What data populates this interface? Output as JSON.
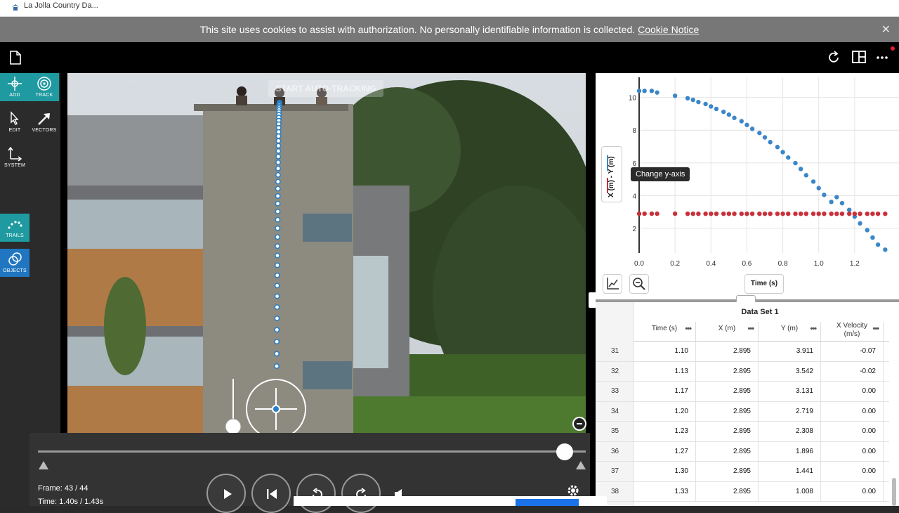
{
  "tab": {
    "title": "La Jolla Country Da..."
  },
  "cookie": {
    "text": "This site uses cookies to assist with authorization. No personally identifiable information is collected.",
    "link": "Cookie Notice",
    "close": "✕"
  },
  "toolbar": {
    "add": "ADD",
    "track": "TRACK",
    "edit": "EDIT",
    "vectors": "VECTORS",
    "system": "SYSTEM",
    "trails": "TRAILS",
    "objects": "OBJECTS"
  },
  "video": {
    "autotrack": "START AUTO-TRACKING"
  },
  "playback": {
    "frame": "Frame: 43 / 44",
    "time": "Time: 1.40s / 1.43s"
  },
  "graph": {
    "y_axis_label": "X (m) - Y (m)",
    "tooltip": "Change y-axis",
    "x_axis_button": "Time (s)"
  },
  "chart_data": {
    "type": "scatter",
    "xlabel": "Time (s)",
    "ylabel": "X (m) - Y (m)",
    "xlim": [
      0.0,
      1.4
    ],
    "ylim": [
      0.5,
      10.8
    ],
    "x_ticks": [
      "0.0",
      "0.2",
      "0.4",
      "0.6",
      "0.8",
      "1.0",
      "1.2"
    ],
    "y_ticks": [
      "2",
      "4",
      "6",
      "8",
      "10"
    ],
    "series": [
      {
        "name": "Y (m)",
        "color": "#3a86c8",
        "x": [
          0.0,
          0.03,
          0.07,
          0.1,
          0.2,
          0.27,
          0.3,
          0.33,
          0.37,
          0.4,
          0.43,
          0.47,
          0.5,
          0.53,
          0.57,
          0.6,
          0.63,
          0.67,
          0.7,
          0.73,
          0.77,
          0.8,
          0.83,
          0.87,
          0.9,
          0.93,
          0.97,
          1.0,
          1.03,
          1.07,
          1.1,
          1.13,
          1.17,
          1.2,
          1.23,
          1.27,
          1.3,
          1.33,
          1.37
        ],
        "y": [
          10.4,
          10.4,
          10.4,
          10.3,
          10.1,
          9.95,
          9.85,
          9.72,
          9.6,
          9.45,
          9.3,
          9.12,
          8.95,
          8.75,
          8.55,
          8.32,
          8.08,
          7.83,
          7.56,
          7.27,
          6.97,
          6.66,
          6.33,
          5.99,
          5.63,
          5.25,
          4.86,
          4.46,
          4.05,
          3.62,
          3.911,
          3.542,
          3.131,
          2.719,
          2.308,
          1.896,
          1.441,
          1.008,
          0.7
        ]
      },
      {
        "name": "X (m)",
        "color": "#c8303a",
        "x": [
          0.0,
          0.03,
          0.07,
          0.1,
          0.2,
          0.27,
          0.3,
          0.33,
          0.37,
          0.4,
          0.43,
          0.47,
          0.5,
          0.53,
          0.57,
          0.6,
          0.63,
          0.67,
          0.7,
          0.73,
          0.77,
          0.8,
          0.83,
          0.87,
          0.9,
          0.93,
          0.97,
          1.0,
          1.03,
          1.07,
          1.1,
          1.13,
          1.17,
          1.2,
          1.23,
          1.27,
          1.3,
          1.33,
          1.37
        ],
        "y": [
          2.9,
          2.9,
          2.9,
          2.9,
          2.9,
          2.895,
          2.895,
          2.895,
          2.895,
          2.895,
          2.895,
          2.895,
          2.895,
          2.895,
          2.895,
          2.895,
          2.895,
          2.895,
          2.895,
          2.895,
          2.895,
          2.895,
          2.895,
          2.895,
          2.895,
          2.895,
          2.895,
          2.895,
          2.895,
          2.895,
          2.895,
          2.895,
          2.895,
          2.895,
          2.895,
          2.895,
          2.895,
          2.895,
          2.895
        ]
      }
    ]
  },
  "table": {
    "title": "Data Set 1",
    "columns": [
      "Time (s)",
      "X (m)",
      "Y (m)",
      "X Velocity\n(m/s)"
    ],
    "rows": [
      {
        "n": "31",
        "t": "1.10",
        "x": "2.895",
        "y": "3.911",
        "v": "-0.07"
      },
      {
        "n": "32",
        "t": "1.13",
        "x": "2.895",
        "y": "3.542",
        "v": "-0.02"
      },
      {
        "n": "33",
        "t": "1.17",
        "x": "2.895",
        "y": "3.131",
        "v": "0.00"
      },
      {
        "n": "34",
        "t": "1.20",
        "x": "2.895",
        "y": "2.719",
        "v": "0.00"
      },
      {
        "n": "35",
        "t": "1.23",
        "x": "2.895",
        "y": "2.308",
        "v": "0.00"
      },
      {
        "n": "36",
        "t": "1.27",
        "x": "2.895",
        "y": "1.896",
        "v": "0.00"
      },
      {
        "n": "37",
        "t": "1.30",
        "x": "2.895",
        "y": "1.441",
        "v": "0.00"
      },
      {
        "n": "38",
        "t": "1.33",
        "x": "2.895",
        "y": "1.008",
        "v": "0.00"
      }
    ]
  }
}
